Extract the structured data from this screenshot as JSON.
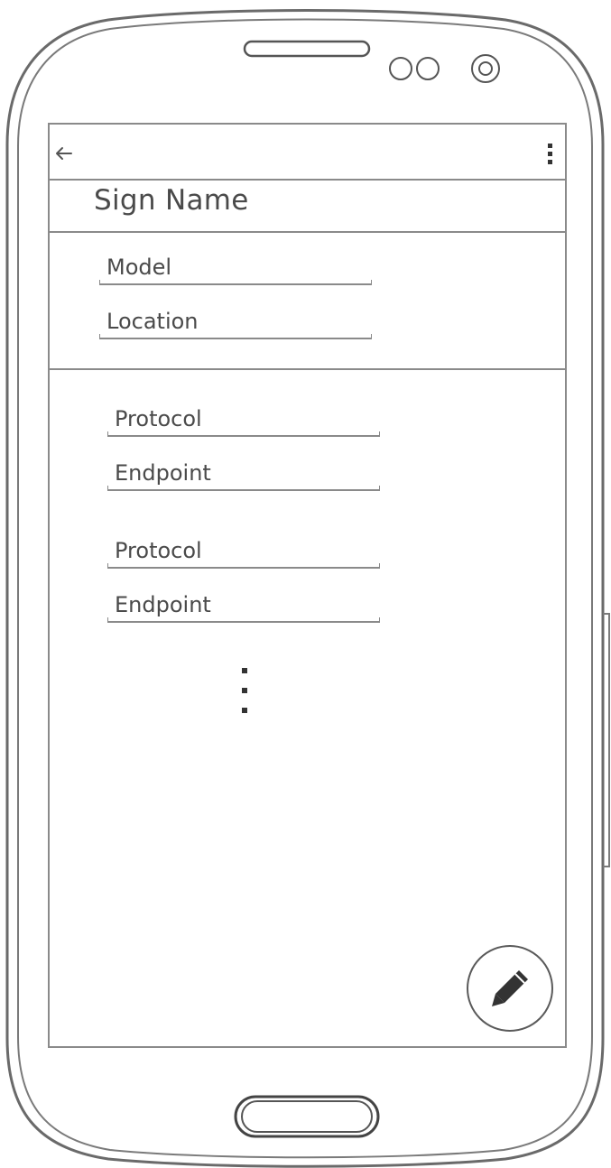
{
  "screen": {
    "title": "Sign Name",
    "icons": {
      "back": "arrow-left-icon",
      "menu": "more-vertical-icon",
      "fab": "pencil-icon",
      "overflow": "vertical-ellipsis-icon"
    }
  },
  "device_fields": [
    {
      "value": "Model"
    },
    {
      "value": "Location"
    }
  ],
  "endpoint_groups": [
    {
      "protocol": "Protocol",
      "endpoint": "Endpoint"
    },
    {
      "protocol": "Protocol",
      "endpoint": "Endpoint"
    }
  ],
  "colors": {
    "stroke": "#8a8a8a",
    "text": "#4a4a4a",
    "background": "#ffffff"
  }
}
